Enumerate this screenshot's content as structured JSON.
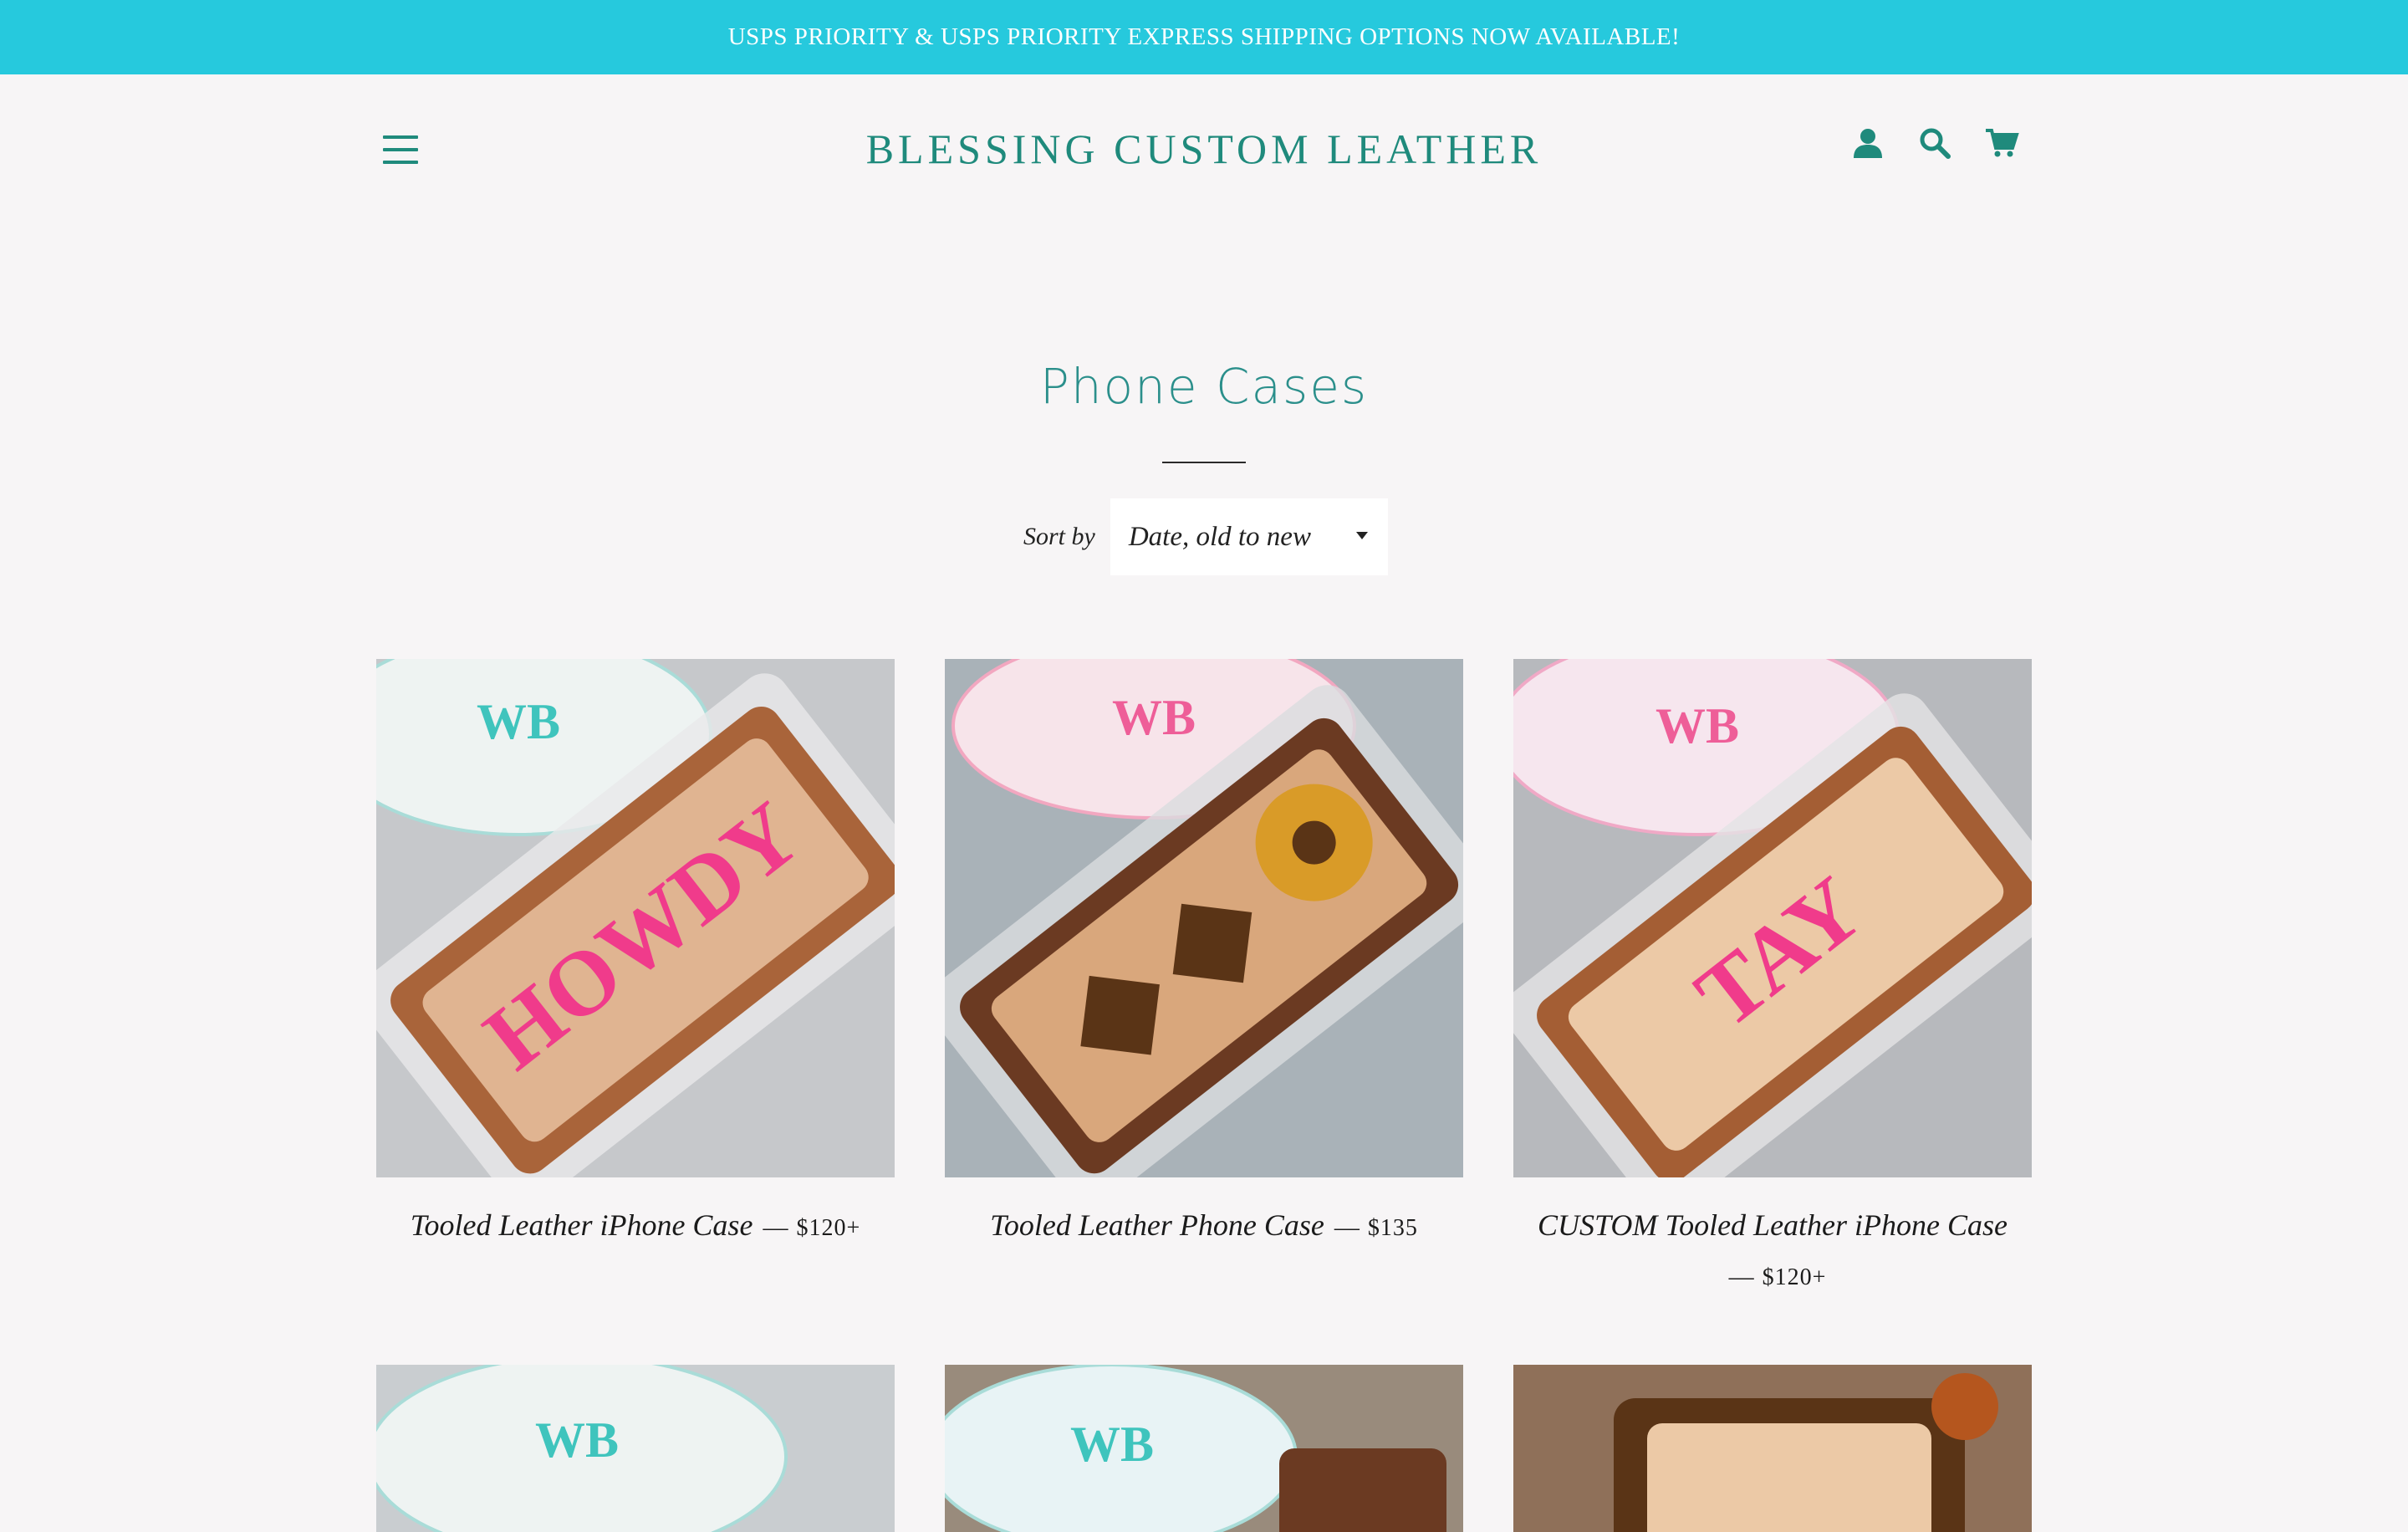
{
  "announcement": "USPS PRIORITY & USPS PRIORITY EXPRESS SHIPPING OPTIONS NOW AVAILABLE!",
  "header": {
    "brand": "BLESSING CUSTOM LEATHER",
    "icons": [
      "menu-icon",
      "account-icon",
      "search-icon",
      "cart-icon"
    ]
  },
  "collection": {
    "title": "Phone Cases",
    "sort_label": "Sort by",
    "sort_value": "Date, old to new"
  },
  "products": [
    {
      "name": "Tooled Leather iPhone Case",
      "dash": "—",
      "price": "$120+"
    },
    {
      "name": "Tooled Leather Phone Case",
      "dash": "—",
      "price": "$135"
    },
    {
      "name": "CUSTOM Tooled Leather iPhone Case",
      "dash": "—",
      "price": "$120+"
    }
  ],
  "colors": {
    "announcement_bg": "#26c9dd",
    "brand": "#1f8a7c",
    "title": "#2b8f8b",
    "page_bg": "#f7f5f6"
  }
}
